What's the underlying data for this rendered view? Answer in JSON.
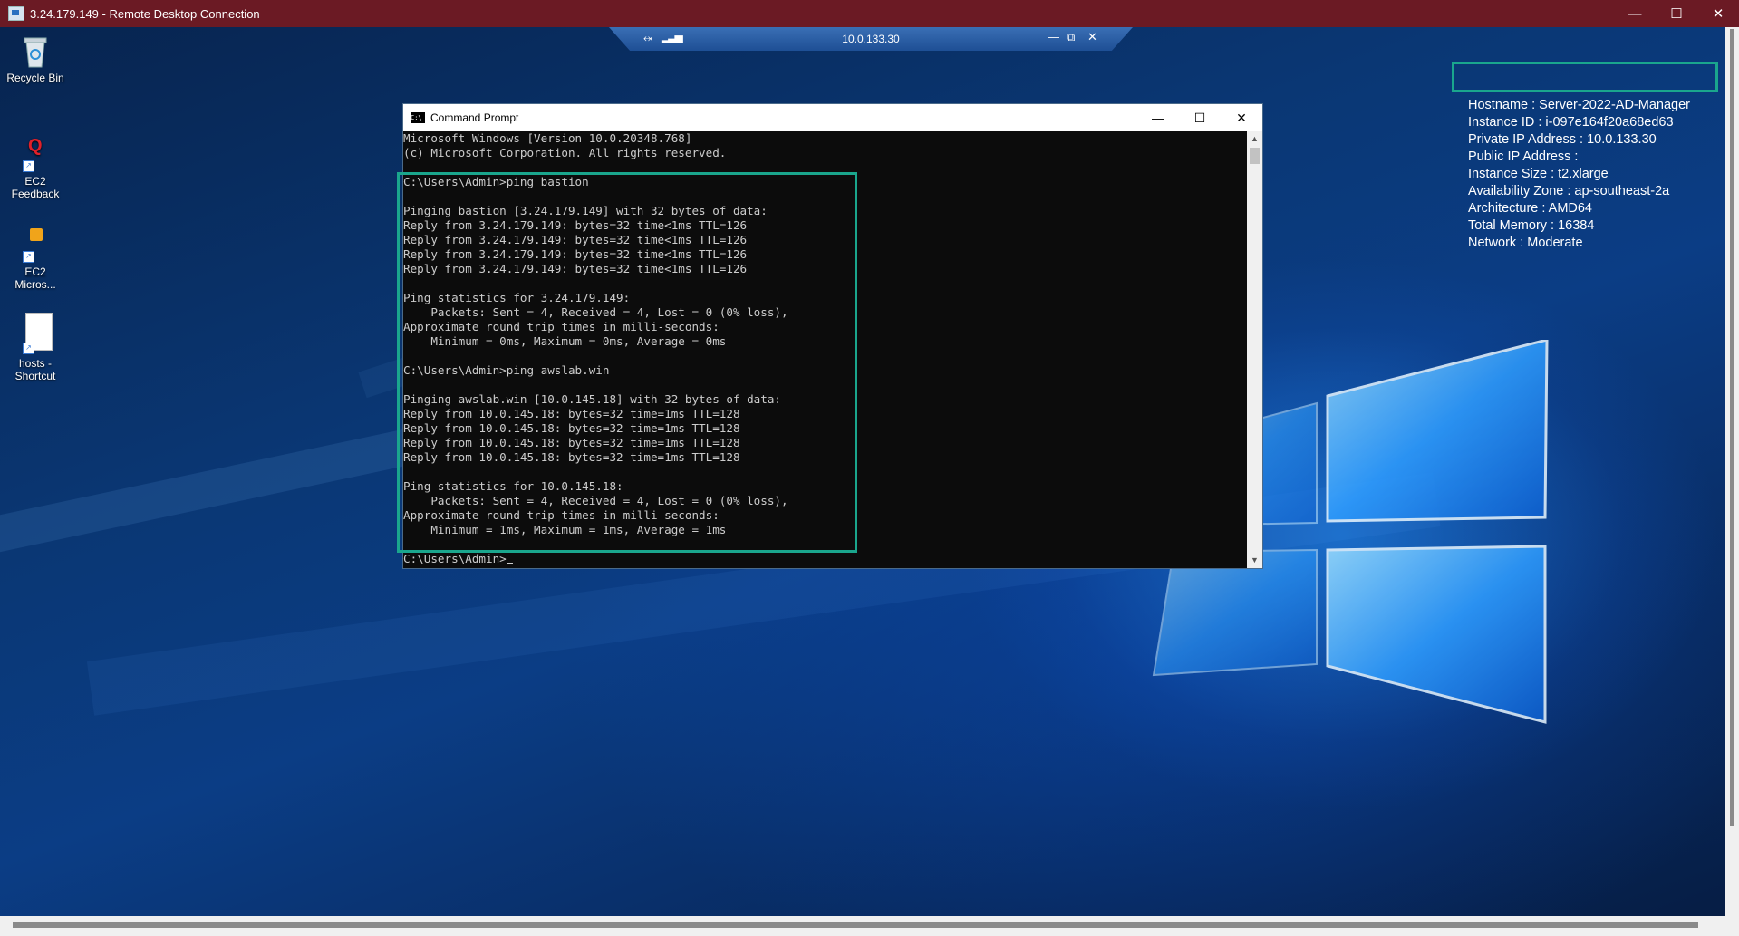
{
  "rdp": {
    "title": "3.24.179.149 - Remote Desktop Connection",
    "connection_bar_ip": "10.0.133.30"
  },
  "desktop_icons": [
    {
      "label": "Recycle Bin",
      "icon": "recycle-bin-icon"
    },
    {
      "label": "EC2\nFeedback",
      "icon": "ec2-feedback-icon"
    },
    {
      "label": "EC2\nMicros...",
      "icon": "ec2-microsoft-icon"
    },
    {
      "label": "hosts -\nShortcut",
      "icon": "file-shortcut-icon"
    }
  ],
  "cmd": {
    "title": "Command Prompt",
    "lines": [
      "Microsoft Windows [Version 10.0.20348.768]",
      "(c) Microsoft Corporation. All rights reserved.",
      "",
      "C:\\Users\\Admin>ping bastion",
      "",
      "Pinging bastion [3.24.179.149] with 32 bytes of data:",
      "Reply from 3.24.179.149: bytes=32 time<1ms TTL=126",
      "Reply from 3.24.179.149: bytes=32 time<1ms TTL=126",
      "Reply from 3.24.179.149: bytes=32 time<1ms TTL=126",
      "Reply from 3.24.179.149: bytes=32 time<1ms TTL=126",
      "",
      "Ping statistics for 3.24.179.149:",
      "    Packets: Sent = 4, Received = 4, Lost = 0 (0% loss),",
      "Approximate round trip times in milli-seconds:",
      "    Minimum = 0ms, Maximum = 0ms, Average = 0ms",
      "",
      "C:\\Users\\Admin>ping awslab.win",
      "",
      "Pinging awslab.win [10.0.145.18] with 32 bytes of data:",
      "Reply from 10.0.145.18: bytes=32 time=1ms TTL=128",
      "Reply from 10.0.145.18: bytes=32 time=1ms TTL=128",
      "Reply from 10.0.145.18: bytes=32 time=1ms TTL=128",
      "Reply from 10.0.145.18: bytes=32 time=1ms TTL=128",
      "",
      "Ping statistics for 10.0.145.18:",
      "    Packets: Sent = 4, Received = 4, Lost = 0 (0% loss),",
      "Approximate round trip times in milli-seconds:",
      "    Minimum = 1ms, Maximum = 1ms, Average = 1ms",
      "",
      "C:\\Users\\Admin>"
    ]
  },
  "bginfo": [
    "Hostname : Server-2022-AD-Manager",
    "Instance ID : i-097e164f20a68ed63",
    "Private IP Address : 10.0.133.30",
    "Public IP Address :",
    "Instance Size : t2.xlarge",
    "Availability Zone : ap-southeast-2a",
    "Architecture : AMD64",
    "Total Memory : 16384",
    "Network : Moderate"
  ],
  "colors": {
    "rdp_titlebar": "#6b1a24",
    "highlight": "#1aa68d",
    "console_bg": "#0c0c0c",
    "console_fg": "#cccccc"
  }
}
